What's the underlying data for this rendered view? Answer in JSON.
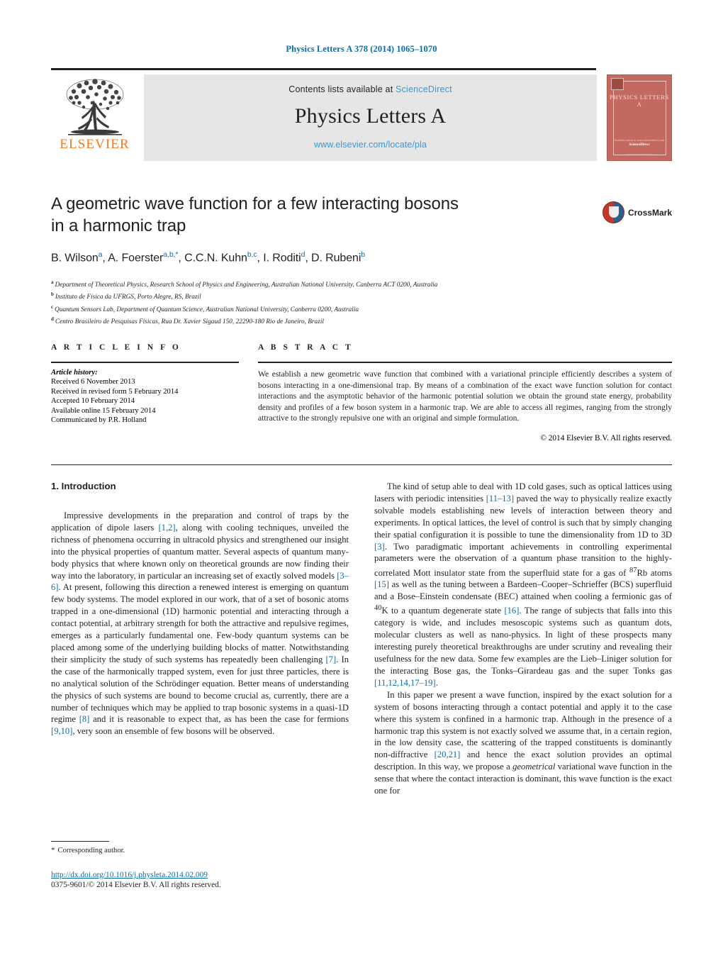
{
  "running_head": "Physics Letters A 378 (2014) 1065–1070",
  "masthead": {
    "contents_prefix": "Contents lists available at ",
    "sciencedirect": "ScienceDirect",
    "journal_title": "Physics Letters A",
    "journal_url": "www.elsevier.com/locate/pla",
    "publisher_name": "ELSEVIER",
    "cover": {
      "title": "PHYSICS LETTERS A",
      "foot1": "Available online at www.sciencedirect.com",
      "foot2": "ScienceDirect",
      "foot3": "www.elsevier.com/locate/pla"
    }
  },
  "article": {
    "title": "A geometric wave function for a few interacting bosons in a harmonic trap",
    "title_line1": "A geometric wave function for a few interacting bosons",
    "title_line2": "in a harmonic trap",
    "crossmark_label": "CrossMark",
    "authors": [
      {
        "name": "B. Wilson",
        "marks": "a"
      },
      {
        "name": "A. Foerster",
        "marks": "a,b,*"
      },
      {
        "name": "C.C.N. Kuhn",
        "marks": "b,c"
      },
      {
        "name": "I. Roditi",
        "marks": "d"
      },
      {
        "name": "D. Rubeni",
        "marks": "b"
      }
    ],
    "affiliations": [
      {
        "mark": "a",
        "text": "Department of Theoretical Physics, Research School of Physics and Engineering, Australian National University, Canberra ACT 0200, Australia"
      },
      {
        "mark": "b",
        "text": "Instituto de Física da UFRGS, Porto Alegre, RS, Brazil"
      },
      {
        "mark": "c",
        "text": "Quantum Sensors Lab, Department of Quantum Science, Australian National University, Canberra 0200, Australia"
      },
      {
        "mark": "d",
        "text": "Centro Brasileiro de Pesquisas Físicas, Rua Dr. Xavier Sigaud 150, 22290-180 Rio de Janeiro, Brazil"
      }
    ]
  },
  "article_info": {
    "heading": "A R T I C L E   I N F O",
    "history_label": "Article history:",
    "history": [
      "Received 6 November 2013",
      "Received in revised form 5 February 2014",
      "Accepted 10 February 2014",
      "Available online 15 February 2014",
      "Communicated by P.R. Holland"
    ]
  },
  "abstract": {
    "heading": "A B S T R A C T",
    "text": "We establish a new geometric wave function that combined with a variational principle efficiently describes a system of bosons interacting in a one-dimensional trap. By means of a combination of the exact wave function solution for contact interactions and the asymptotic behavior of the harmonic potential solution we obtain the ground state energy, probability density and profiles of a few boson system in a harmonic trap. We are able to access all regimes, ranging from the strongly attractive to the strongly repulsive one with an original and simple formulation.",
    "copyright": "© 2014 Elsevier B.V. All rights reserved."
  },
  "body": {
    "section_title": "1. Introduction",
    "left_paragraphs": [
      "Impressive developments in the preparation and control of traps by the application of dipole lasers [1,2], along with cooling techniques, unveiled the richness of phenomena occurring in ultracold physics and strengthened our insight into the physical properties of quantum matter. Several aspects of quantum many-body physics that where known only on theoretical grounds are now finding their way into the laboratory, in particular an increasing set of exactly solved models [3–6]. At present, following this direction a renewed interest is emerging on quantum few body systems. The model explored in our work, that of a set of bosonic atoms trapped in a one-dimensional (1D) harmonic potential and interacting through a contact potential, at arbitrary strength for both the attractive and repulsive regimes, emerges as a particularly fundamental one. Few-body quantum systems can be placed among some of the underlying building blocks of matter. Notwithstanding their simplicity the study of such systems has repeatedly been challenging [7]. In the case of the harmonically trapped system, even for just three particles, there is no analytical solution of the Schrödinger equation. Better means of understanding the physics of such systems are bound to become crucial as, currently, there are a number of techniques which may be applied to trap bosonic systems in a quasi-1D regime [8] and it is reasonable to expect that, as has been the case for fermions [9,10], very soon an ensemble of few bosons will be observed."
    ],
    "right_paragraphs": [
      "The kind of setup able to deal with 1D cold gases, such as optical lattices using lasers with periodic intensities [11–13] paved the way to physically realize exactly solvable models establishing new levels of interaction between theory and experiments. In optical lattices, the level of control is such that by simply changing their spatial configuration it is possible to tune the dimensionality from 1D to 3D [3]. Two paradigmatic important achievements in controlling experimental parameters were the observation of a quantum phase transition to the highly-correlated Mott insulator state from the superfluid state for a gas of 87Rb atoms [15] as well as the tuning between a Bardeen–Cooper–Schrieffer (BCS) superfluid and a Bose–Einstein condensate (BEC) attained when cooling a fermionic gas of 40K to a quantum degenerate state [16]. The range of subjects that falls into this category is wide, and includes mesoscopic systems such as quantum dots, molecular clusters as well as nano-physics. In light of these prospects many interesting purely theoretical breakthroughs are under scrutiny and revealing their usefulness for the new data. Some few examples are the Lieb–Liniger solution for the interacting Bose gas, the Tonks–Girardeau gas and the super Tonks gas [11,12,14,17–19].",
      "In this paper we present a wave function, inspired by the exact solution for a system of bosons interacting through a contact potential and apply it to the case where this system is confined in a harmonic trap. Although in the presence of a harmonic trap this system is not exactly solved we assume that, in a certain region, in the low density case, the scattering of the trapped constituents is dominantly non-diffractive [20,21] and hence the exact solution provides an optimal description. In this way, we propose a geometrical variational wave function in the sense that where the contact interaction is dominant, this wave function is the exact one for"
    ]
  },
  "footer": {
    "corresponding_star": "*",
    "corresponding_text": "Corresponding author.",
    "doi": "http://dx.doi.org/10.1016/j.physleta.2014.02.009",
    "issn_line": "0375-9601/© 2014 Elsevier B.V. All rights reserved."
  },
  "colors": {
    "link_blue": "#0b6ea8",
    "sciencedirect_blue": "#3a97d3",
    "elsevier_orange": "#f47920",
    "cover_red": "#c4695f",
    "text_black": "#231f20"
  }
}
